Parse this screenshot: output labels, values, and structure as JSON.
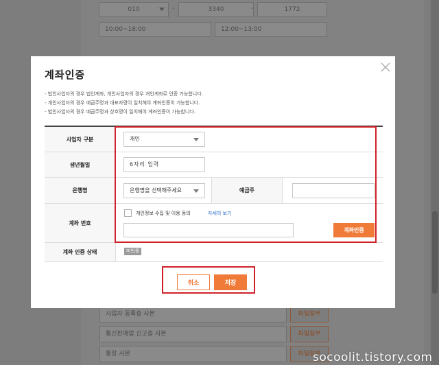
{
  "background": {
    "phone": {
      "prefix": "010",
      "middle": "3340",
      "last": "1772",
      "dash": "-"
    },
    "hours": {
      "from": "10:00~18:00",
      "to": "12:00~13:00"
    },
    "docs": [
      {
        "label": "사업자 등록증 사본",
        "button": "파일첨부"
      },
      {
        "label": "통신판매업 신고증 사본",
        "button": "파일첨부"
      },
      {
        "label": "통장 사본",
        "button": "파일첨부"
      }
    ]
  },
  "modal": {
    "title": "계좌인증",
    "notes": [
      "- 법인사업자의 경우 법인계좌, 개인사업자의 경우 개인계좌로 인증 가능합니다.",
      "- 개인사업자의 경우 예금주명과 대표자명이 일치해야 계좌인증이 가능합니다.",
      "- 법인사업자의 경우 예금주명과 상호명이 일치해야 계좌인증이 가능합니다."
    ],
    "form": {
      "business_type": {
        "label": "사업자 구분",
        "value": "개인"
      },
      "birthdate": {
        "label": "생년월일",
        "placeholder": "6자리 입력"
      },
      "bank": {
        "label": "은행명",
        "placeholder": "은행명을 선택해주세요"
      },
      "holder": {
        "label": "예금주",
        "value": ""
      },
      "account": {
        "label": "계좌 번호",
        "consent": "개인정보 수집 및 이용 동의",
        "consent_link": "자세히 보기",
        "verify_button": "계좌인증",
        "value": ""
      },
      "status": {
        "label": "계좌 인증 상태",
        "badge": "미인증"
      }
    },
    "buttons": {
      "cancel": "취소",
      "save": "저장"
    }
  },
  "watermark": "socoolit.tistory.com",
  "colors": {
    "accent": "#f07b39",
    "highlight": "#d0202a",
    "link": "#2a6fc9"
  }
}
